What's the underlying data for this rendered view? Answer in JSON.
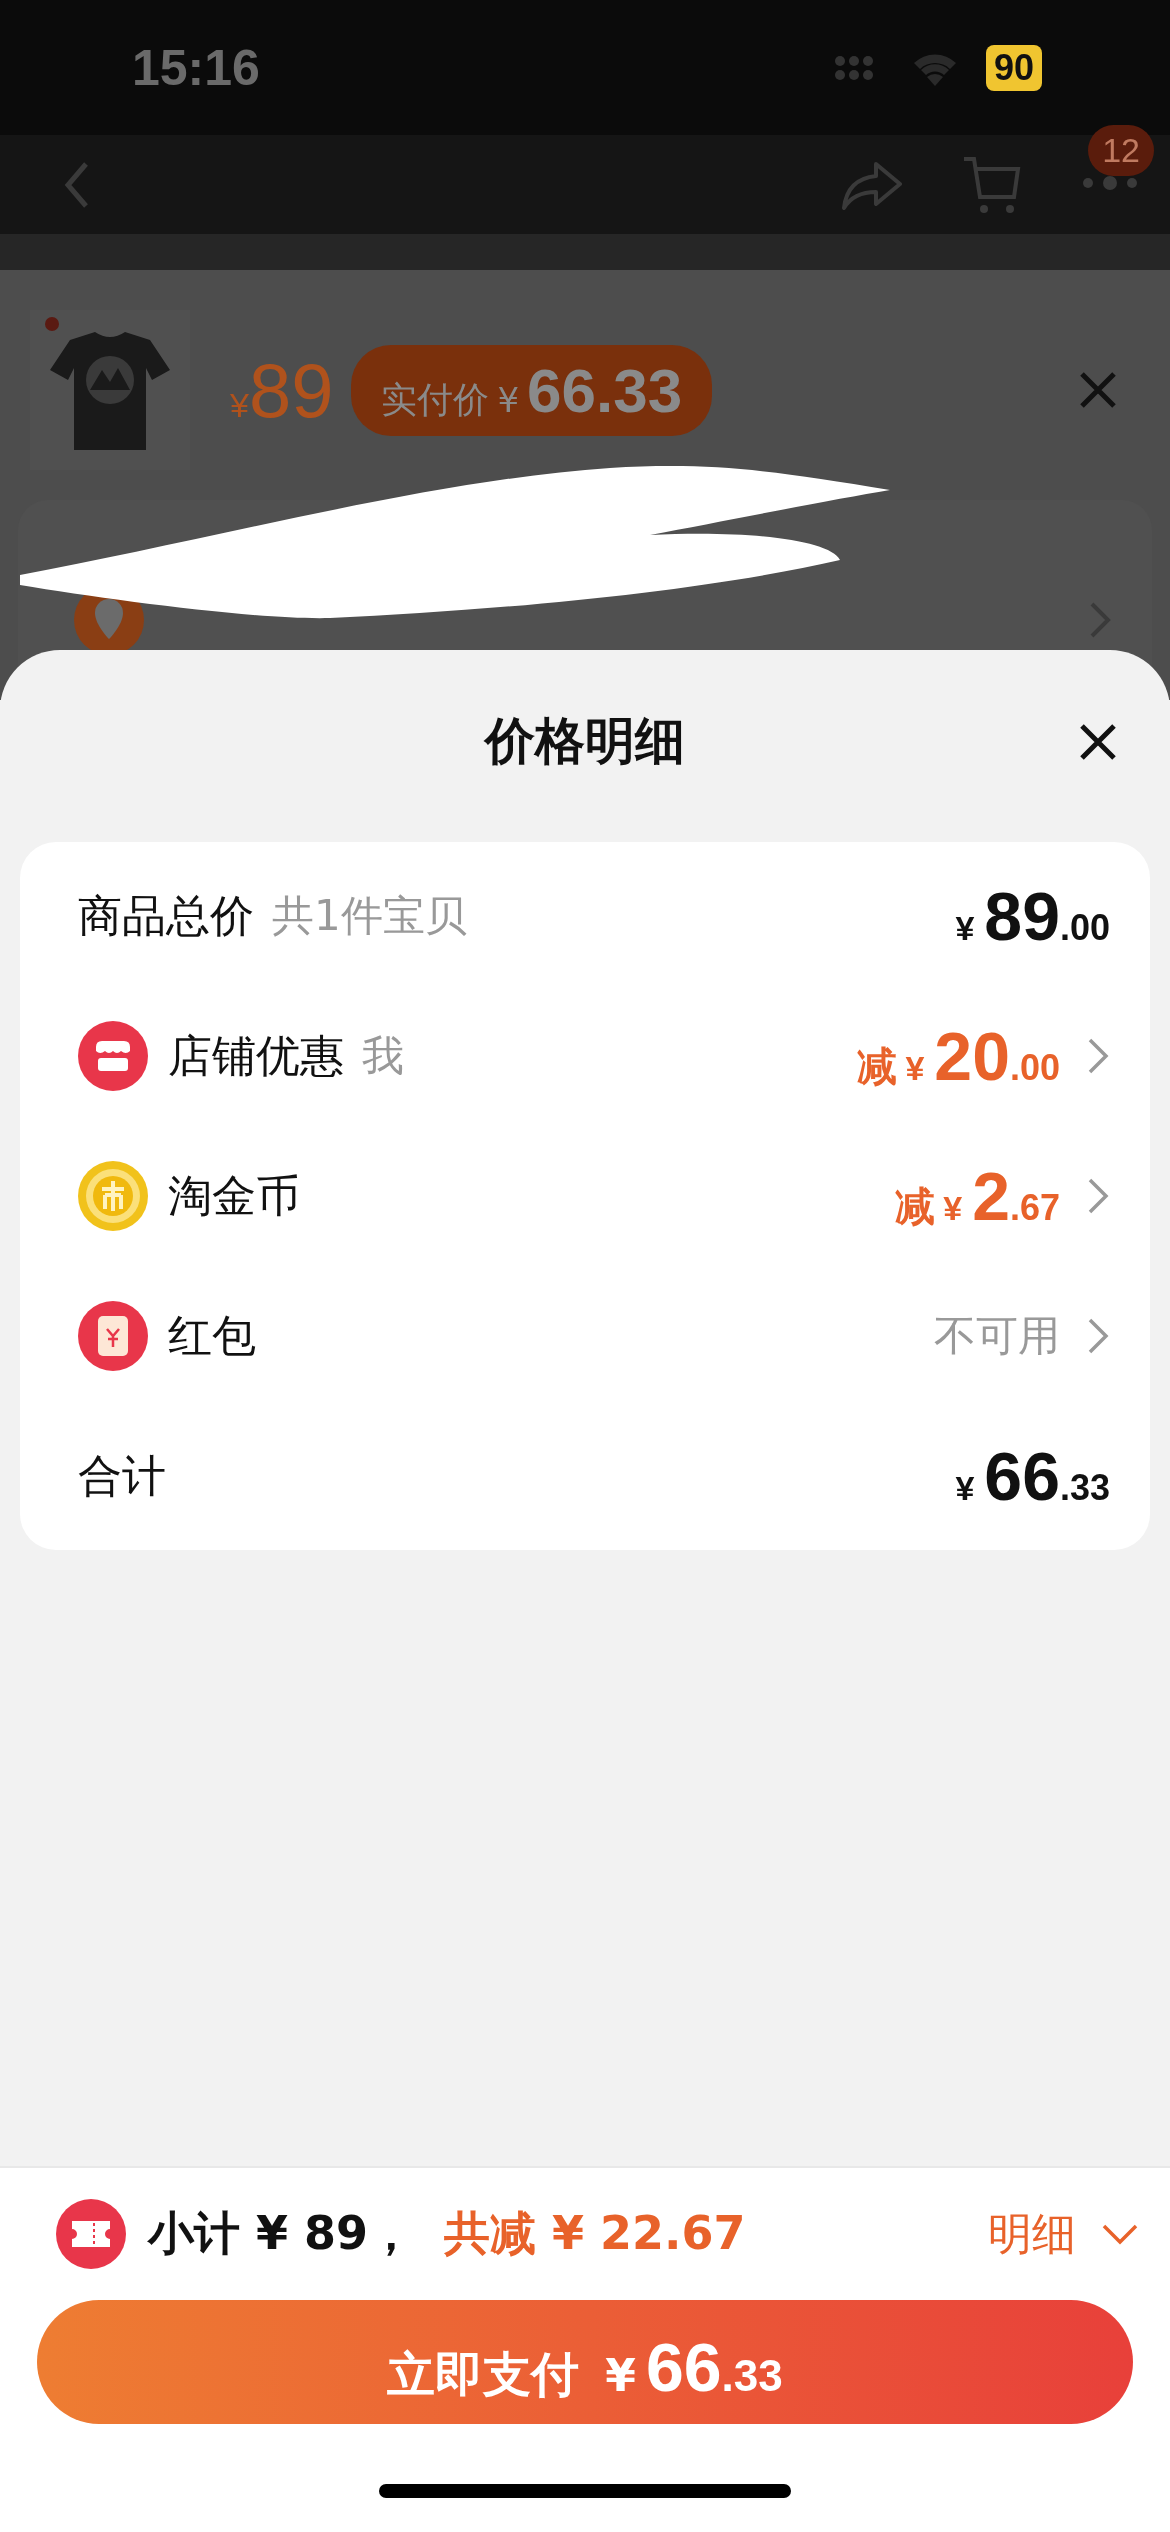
{
  "status_bar": {
    "time": "15:16",
    "battery": "90"
  },
  "nav": {
    "more_badge": "12"
  },
  "product": {
    "currency": "¥",
    "price": "89",
    "paid_label": "实付价",
    "paid_currency": "¥",
    "paid_amount": "66.33"
  },
  "sheet": {
    "title": "价格明细",
    "rows": [
      {
        "kind": "total",
        "label": "商品总价",
        "note": "共1件宝贝",
        "currency": "¥",
        "integer": "89",
        "decimal": ".00"
      },
      {
        "kind": "store",
        "label": "店铺优惠",
        "note": "我",
        "prefix": "减",
        "currency": "¥",
        "integer": "20",
        "decimal": ".00"
      },
      {
        "kind": "coins",
        "label": "淘金币",
        "prefix": "减",
        "currency": "¥",
        "integer": "2",
        "decimal": ".67"
      },
      {
        "kind": "packet",
        "label": "红包",
        "status": "不可用"
      },
      {
        "kind": "total",
        "label": "合计",
        "currency": "¥",
        "integer": "66",
        "decimal": ".33"
      }
    ]
  },
  "summary": {
    "subtotal": "小计 ¥ 89，",
    "saved": "共减 ¥ 22.67",
    "details": "明细"
  },
  "pay_button": {
    "label": "立即支付",
    "currency": "¥",
    "integer": "66",
    "decimal": ".33"
  }
}
